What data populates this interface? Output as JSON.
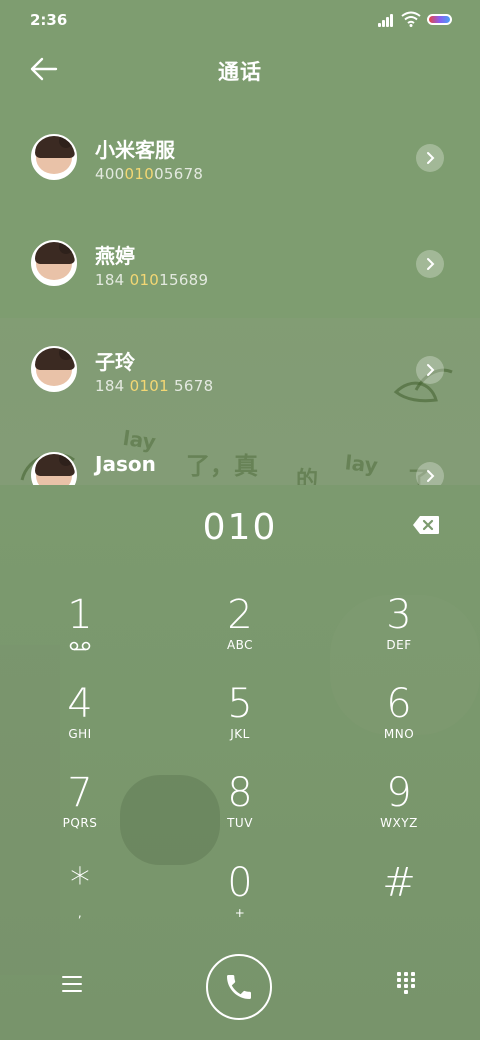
{
  "status": {
    "time": "2:36"
  },
  "header": {
    "title": "通话"
  },
  "contacts": [
    {
      "name": "小米客服",
      "num_pre": "400",
      "num_hl": "010",
      "num_post": "05678"
    },
    {
      "name": "燕婷",
      "num_pre": "184 ",
      "num_hl": "010",
      "num_post": "15689"
    },
    {
      "name": "子玲",
      "num_pre": "184 ",
      "num_hl": "0101",
      "num_post": " 5678"
    },
    {
      "name": "Jason",
      "num_pre": "",
      "num_hl": "",
      "num_post": ""
    }
  ],
  "wallpaper_text": {
    "w1": "lay",
    "w2": "了，真",
    "w3": "的",
    "w4": "lay",
    "w5": "了"
  },
  "dialpad": {
    "input": "010",
    "keys": [
      {
        "digit": "1",
        "letters": ""
      },
      {
        "digit": "2",
        "letters": "ABC"
      },
      {
        "digit": "3",
        "letters": "DEF"
      },
      {
        "digit": "4",
        "letters": "GHI"
      },
      {
        "digit": "5",
        "letters": "JKL"
      },
      {
        "digit": "6",
        "letters": "MNO"
      },
      {
        "digit": "7",
        "letters": "PQRS"
      },
      {
        "digit": "8",
        "letters": "TUV"
      },
      {
        "digit": "9",
        "letters": "WXYZ"
      },
      {
        "digit": "*",
        "letters": ","
      },
      {
        "digit": "0",
        "letters": "+"
      },
      {
        "digit": "#",
        "letters": ""
      }
    ]
  },
  "icons": {
    "back": "back-arrow-icon",
    "chevron": "chevron-right-icon",
    "backspace": "backspace-icon",
    "voicemail": "voicemail-icon",
    "call": "phone-call-icon",
    "menu": "menu-icon",
    "keypad": "keypad-icon"
  },
  "colors": {
    "background": "#7b9a6e",
    "highlight": "#f3d774"
  }
}
